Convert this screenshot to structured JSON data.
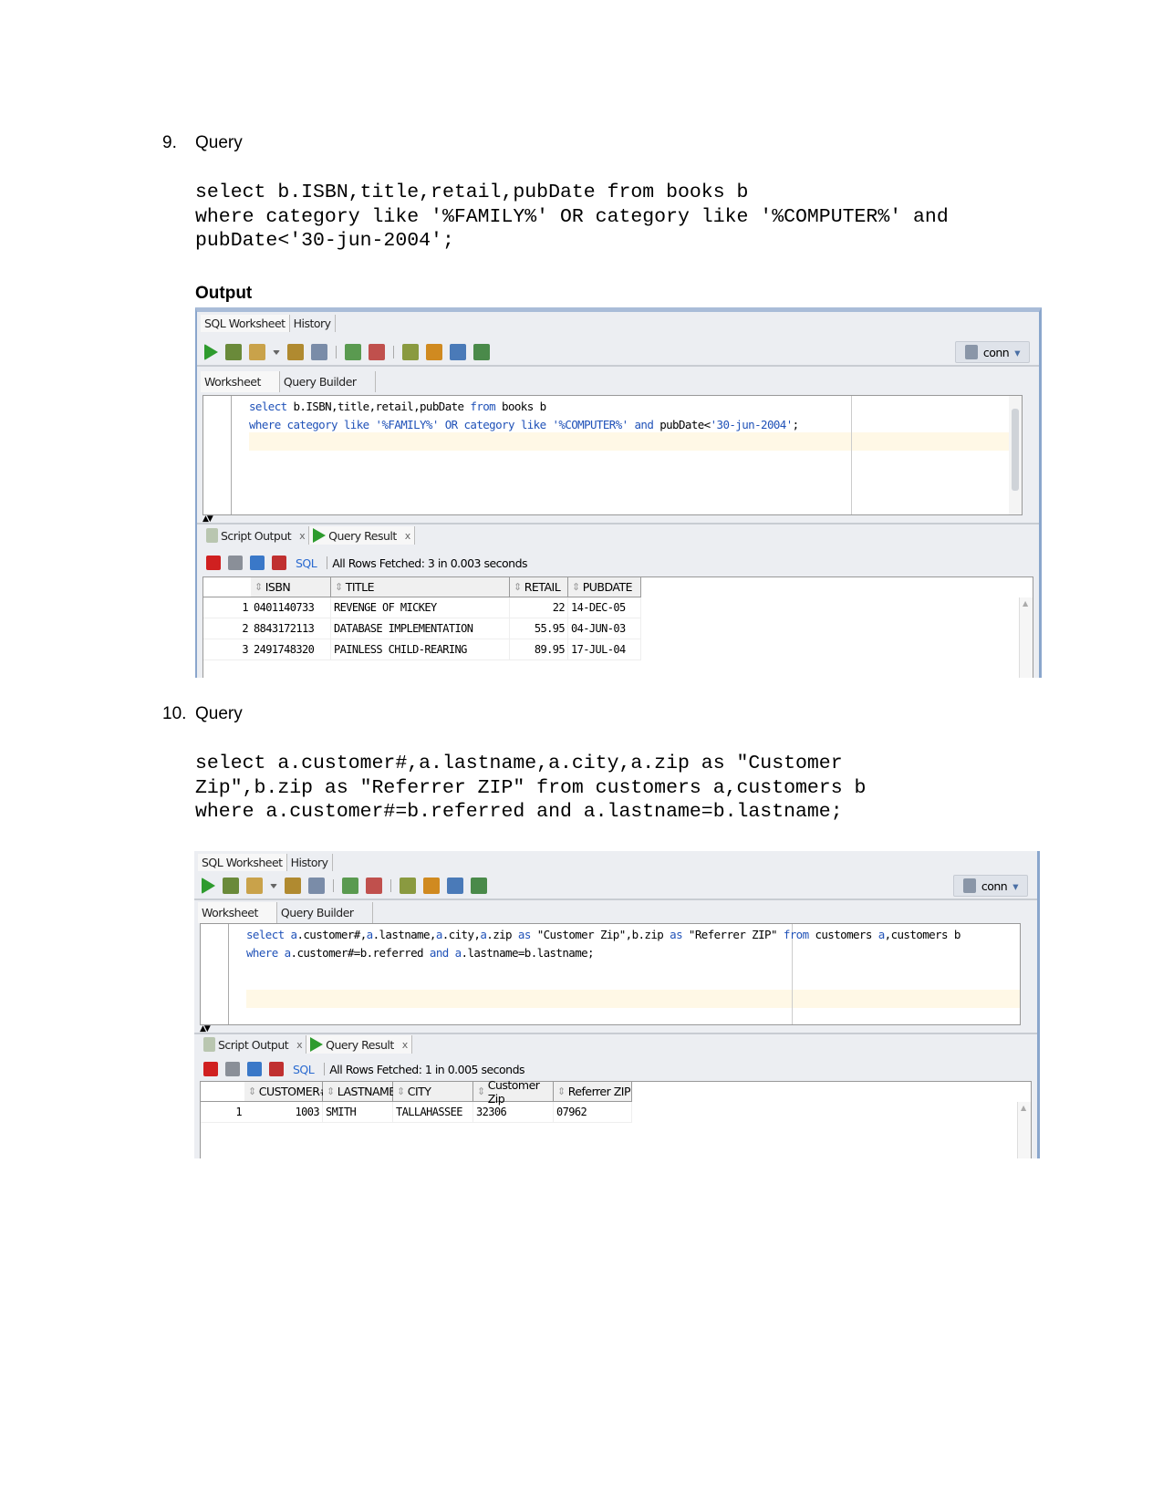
{
  "sections": [
    {
      "number": "9.",
      "heading": "Query",
      "query_lines": [
        "select b.ISBN,title,retail,pubDate from books b",
        "where category like '%FAMILY%' OR category like '%COMPUTER%' and",
        "pubDate<'30-jun-2004';"
      ],
      "output_label": "Output"
    },
    {
      "number": "10.",
      "heading": "Query",
      "query_lines": [
        "select a.customer#,a.lastname,a.city,a.zip as \"Customer",
        "Zip\",b.zip as \"Referrer ZIP\" from customers a,customers b",
        "where a.customer#=b.referred and a.lastname=b.lastname;"
      ]
    }
  ],
  "panels": [
    {
      "tabs": [
        "SQL Worksheet",
        "History"
      ],
      "conn_label": "conn",
      "subtabs": [
        "Worksheet",
        "Query Builder"
      ],
      "editor_lines": [
        [
          [
            "select",
            "kw"
          ],
          [
            " b.ISBN,title,retail,pubDate ",
            ""
          ],
          [
            "from",
            "kw"
          ],
          [
            " books b",
            ""
          ]
        ],
        [
          [
            "where category like ",
            "kw"
          ],
          [
            "'%FAMILY%'",
            "st"
          ],
          [
            " OR category like ",
            "kw"
          ],
          [
            "'%COMPUTER%'",
            "st"
          ],
          [
            " and ",
            "kw"
          ],
          [
            "pubDate<",
            ""
          ],
          [
            "'30-jun-2004'",
            "st"
          ],
          [
            ";",
            ""
          ]
        ]
      ],
      "result_tabs": [
        "Script Output",
        "Query Result"
      ],
      "sql_link": "SQL",
      "status": "All Rows Fetched: 3 in 0.003 seconds",
      "columns": [
        "ISBN",
        "TITLE",
        "RETAIL",
        "PUBDATE"
      ],
      "rows": [
        [
          "1",
          "0401140733",
          "REVENGE OF MICKEY",
          "22",
          "14-DEC-05"
        ],
        [
          "2",
          "8843172113",
          "DATABASE IMPLEMENTATION",
          "55.95",
          "04-JUN-03"
        ],
        [
          "3",
          "2491748320",
          "PAINLESS CHILD-REARING",
          "89.95",
          "17-JUL-04"
        ]
      ]
    },
    {
      "tabs": [
        "SQL Worksheet",
        "History"
      ],
      "conn_label": "conn",
      "subtabs": [
        "Worksheet",
        "Query Builder"
      ],
      "editor_lines": [
        [
          [
            "select",
            "kw"
          ],
          [
            " ",
            ""
          ],
          [
            "a",
            "kw"
          ],
          [
            ".customer#,",
            ""
          ],
          [
            "a",
            "kw"
          ],
          [
            ".lastname,",
            ""
          ],
          [
            "a",
            "kw"
          ],
          [
            ".city,",
            ""
          ],
          [
            "a",
            "kw"
          ],
          [
            ".zip ",
            ""
          ],
          [
            "as",
            "kw"
          ],
          [
            " \"Customer Zip\",b.zip ",
            ""
          ],
          [
            "as",
            "kw"
          ],
          [
            " \"Referrer ZIP\" ",
            ""
          ],
          [
            "from",
            "kw"
          ],
          [
            " customers ",
            ""
          ],
          [
            "a",
            "kw"
          ],
          [
            ",customers b",
            ""
          ]
        ],
        [
          [
            "where",
            "kw"
          ],
          [
            " ",
            ""
          ],
          [
            "a",
            "kw"
          ],
          [
            ".customer#=b.referred ",
            ""
          ],
          [
            "and",
            "kw"
          ],
          [
            " ",
            ""
          ],
          [
            "a",
            "kw"
          ],
          [
            ".lastname=b.lastname;",
            ""
          ]
        ]
      ],
      "result_tabs": [
        "Script Output",
        "Query Result"
      ],
      "sql_link": "SQL",
      "status": "All Rows Fetched: 1 in 0.005 seconds",
      "columns": [
        "CUSTOMER#",
        "LASTNAME",
        "CITY",
        "Customer Zip",
        "Referrer ZIP"
      ],
      "rows": [
        [
          "1",
          "1003",
          "SMITH",
          "TALLAHASSEE",
          "32306",
          "07962"
        ]
      ]
    }
  ],
  "colors": {
    "accent": "#8aa6cc",
    "keyword": "#2052b8",
    "run_green": "#2e9b2e"
  }
}
